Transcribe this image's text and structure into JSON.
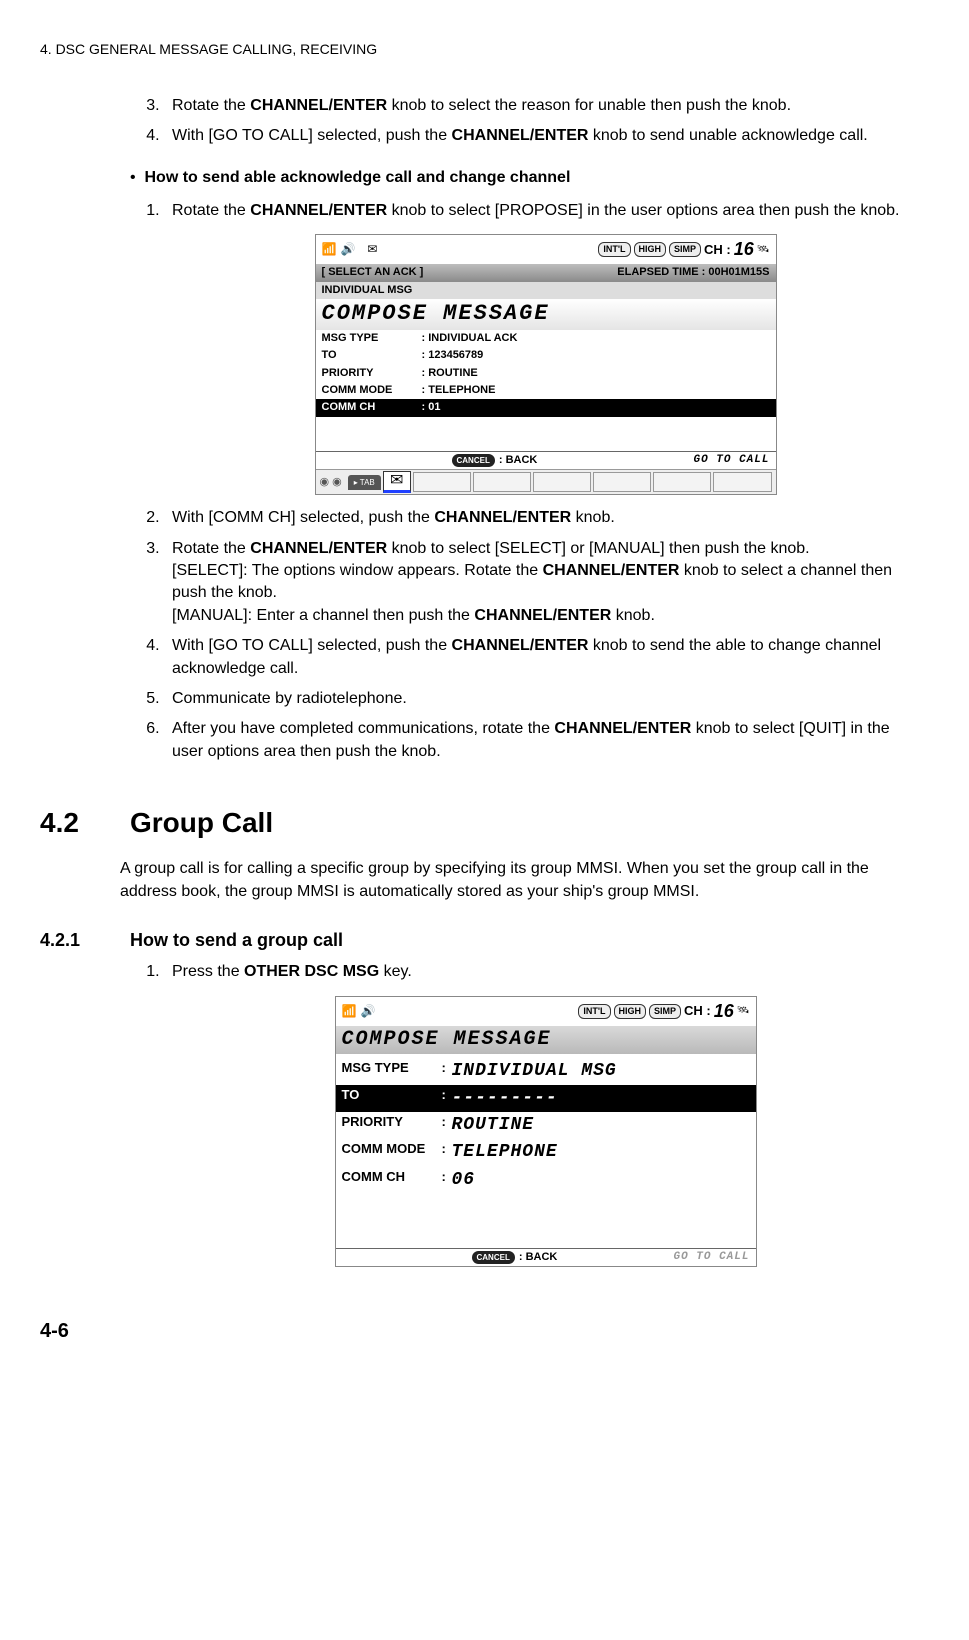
{
  "header": "4.  DSC GENERAL MESSAGE CALLING, RECEIVING",
  "steps_a": {
    "s3": {
      "pre": "Rotate the ",
      "bold": "CHANNEL/ENTER",
      "post": " knob to select the reason for unable then push the knob."
    },
    "s4": {
      "pre": "With [GO TO CALL] selected, push the ",
      "bold": "CHANNEL/ENTER",
      "post": " knob to send unable acknowledge call."
    }
  },
  "bullet": "How to send able acknowledge call and change channel",
  "steps_b": {
    "s1": {
      "pre": "Rotate the ",
      "bold": "CHANNEL/ENTER",
      "post": " knob to select [PROPOSE] in the user options area then push the knob."
    },
    "s2": {
      "pre": "With [COMM CH] selected, push the ",
      "bold": "CHANNEL/ENTER",
      "post": " knob."
    },
    "s3": {
      "line1_pre": "Rotate the ",
      "line1_bold": "CHANNEL/ENTER",
      "line1_post": " knob to select [SELECT] or [MANUAL] then push the knob.",
      "line2_pre": "[SELECT]: The options window appears. Rotate the ",
      "line2_bold": "CHANNEL/ENTER",
      "line2_post": " knob to select a channel then push the knob.",
      "line3_pre": "[MANUAL]: Enter a channel then push the ",
      "line3_bold": "CHANNEL/ENTER",
      "line3_post": " knob."
    },
    "s4": {
      "pre": "With [GO TO CALL] selected, push the ",
      "bold": "CHANNEL/ENTER",
      "post": " knob to send the able to change channel acknowledge call."
    },
    "s5": "Communicate by radiotelephone.",
    "s6": {
      "pre": "After you have completed communications, rotate the ",
      "bold": "CHANNEL/ENTER",
      "post": " knob to select [QUIT] in the user options area then push the knob."
    }
  },
  "section": {
    "num": "4.2",
    "title": "Group Call",
    "intro": "A group call is for calling a specific group by specifying its group MMSI. When you set the group call in the address book, the group MMSI is automatically stored as your ship's group MMSI."
  },
  "subsection": {
    "num": "4.2.1",
    "title": "How to send a group call",
    "step1_pre": "Press the ",
    "step1_bold": "OTHER DSC MSG",
    "step1_post": " key."
  },
  "screenshot1": {
    "pills": {
      "a": "INT'L",
      "b": "HIGH",
      "c": "SIMP"
    },
    "ch_label": "CH :",
    "ch_num": "16",
    "bar1_left": "[ SELECT  AN  ACK ]",
    "bar1_right": "ELAPSED  TIME : 00H01M15S",
    "bar2": "INDIVIDUAL  MSG",
    "compose": "COMPOSE MESSAGE",
    "rows": [
      {
        "label": "MSG TYPE",
        "value": ": INDIVIDUAL  ACK"
      },
      {
        "label": "TO",
        "value": ": 123456789"
      },
      {
        "label": "PRIORITY",
        "value": ": ROUTINE"
      },
      {
        "label": "COMM MODE",
        "value": ": TELEPHONE"
      },
      {
        "label": "COMM CH",
        "value": ": 01"
      }
    ],
    "cancel": "CANCEL",
    "back": ": BACK",
    "gotocall": "GO TO CALL",
    "tab_label": "TAB"
  },
  "screenshot2": {
    "pills": {
      "a": "INT'L",
      "b": "HIGH",
      "c": "SIMP"
    },
    "ch_label": "CH :",
    "ch_num": "16",
    "compose": "COMPOSE MESSAGE",
    "rows": [
      {
        "label": "MSG TYPE",
        "colon": ":",
        "value": "INDIVIDUAL MSG"
      },
      {
        "label": "TO",
        "colon": ":",
        "value": "---------"
      },
      {
        "label": "PRIORITY",
        "colon": ":",
        "value": "ROUTINE"
      },
      {
        "label": "COMM MODE",
        "colon": ":",
        "value": "TELEPHONE"
      },
      {
        "label": "COMM CH",
        "colon": ":",
        "value": "06"
      }
    ],
    "cancel": "CANCEL",
    "back": ": BACK",
    "gotocall": "GO TO CALL"
  },
  "pagenum": "4-6"
}
